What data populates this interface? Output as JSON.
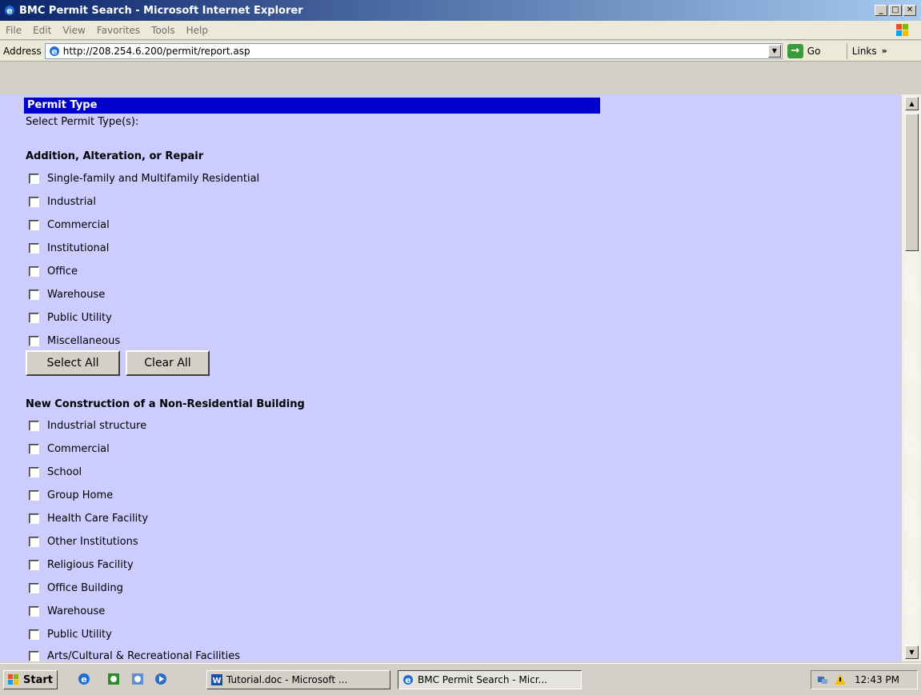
{
  "window": {
    "title": "BMC Permit Search - Microsoft Internet Explorer"
  },
  "menu": [
    "File",
    "Edit",
    "View",
    "Favorites",
    "Tools",
    "Help"
  ],
  "address": {
    "label": "Address",
    "url": "http://208.254.6.200/permit/report.asp",
    "go": "Go",
    "links": "Links",
    "links_chevron": "»"
  },
  "content": {
    "header": "Permit Type",
    "instruction": "Select Permit Type(s):",
    "section1": {
      "title": "Addition, Alteration, or Repair",
      "options": [
        "Single-family and Multifamily Residential",
        "Industrial",
        "Commercial",
        "Institutional",
        "Office",
        "Warehouse",
        "Public Utility",
        "Miscellaneous"
      ],
      "select_all": "Select All",
      "clear_all": "Clear All"
    },
    "section2": {
      "title": "New Construction of a Non-Residential Building",
      "options": [
        "Industrial structure",
        "Commercial",
        "School",
        "Group Home",
        "Health Care Facility",
        "Other Institutions",
        "Religious Facility",
        "Office Building",
        "Warehouse",
        "Public Utility",
        "Arts/Cultural & Recreational Facilities"
      ]
    }
  },
  "taskbar": {
    "start": "Start",
    "tasks": [
      "Tutorial.doc - Microsoft ...",
      "BMC Permit Search - Micr..."
    ],
    "clock": "12:43 PM"
  },
  "colors": {
    "content_bg": "#ccccff",
    "header_bg": "#0000cc"
  }
}
